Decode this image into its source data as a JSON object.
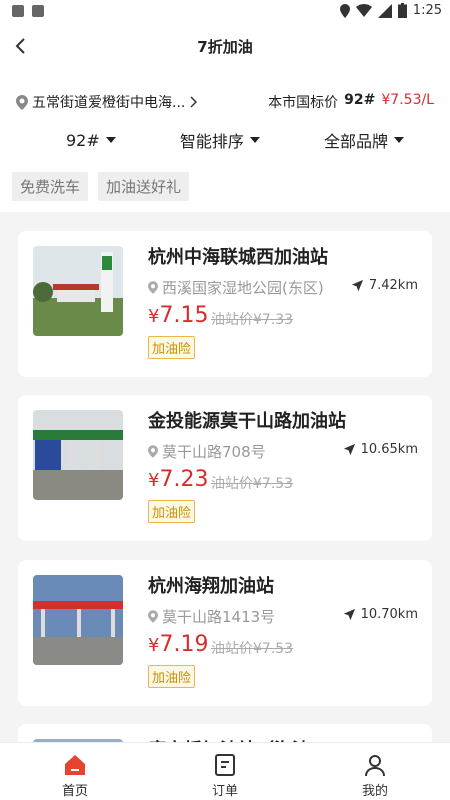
{
  "status": {
    "time": "1:25"
  },
  "header": {
    "title": "7折加油",
    "location": "五常街道爱橙街中电海...",
    "price_label": "本市国标价",
    "fuel_code": "92#",
    "price_value": "¥7.53/L"
  },
  "filters": [
    {
      "label": "92#"
    },
    {
      "label": "智能排序"
    },
    {
      "label": "全部品牌"
    }
  ],
  "tags": [
    "免费洗车",
    "加油送好礼"
  ],
  "stations": [
    {
      "name": "杭州中海联城西加油站",
      "address": "西溪国家湿地公园(东区)",
      "distance": "7.42km",
      "price": "7.15",
      "currency": "¥",
      "original": "油站价¥7.33",
      "badge": "加油险"
    },
    {
      "name": "金投能源莫干山路加油站",
      "address": "莫干山路708号",
      "distance": "10.65km",
      "price": "7.23",
      "currency": "¥",
      "original": "油站价¥7.53",
      "badge": "加油险"
    },
    {
      "name": "杭州海翔加油站",
      "address": "莫干山路1413号",
      "distance": "10.70km",
      "price": "7.19",
      "currency": "¥",
      "original": "油站价¥7.53",
      "badge": "加油险"
    },
    {
      "name": "康家桥加油站（海油"
    }
  ],
  "tabbar": [
    {
      "label": "首页"
    },
    {
      "label": "订单"
    },
    {
      "label": "我的"
    }
  ],
  "colors": {
    "accent": "#d62e2e",
    "badge": "#c8900a"
  }
}
